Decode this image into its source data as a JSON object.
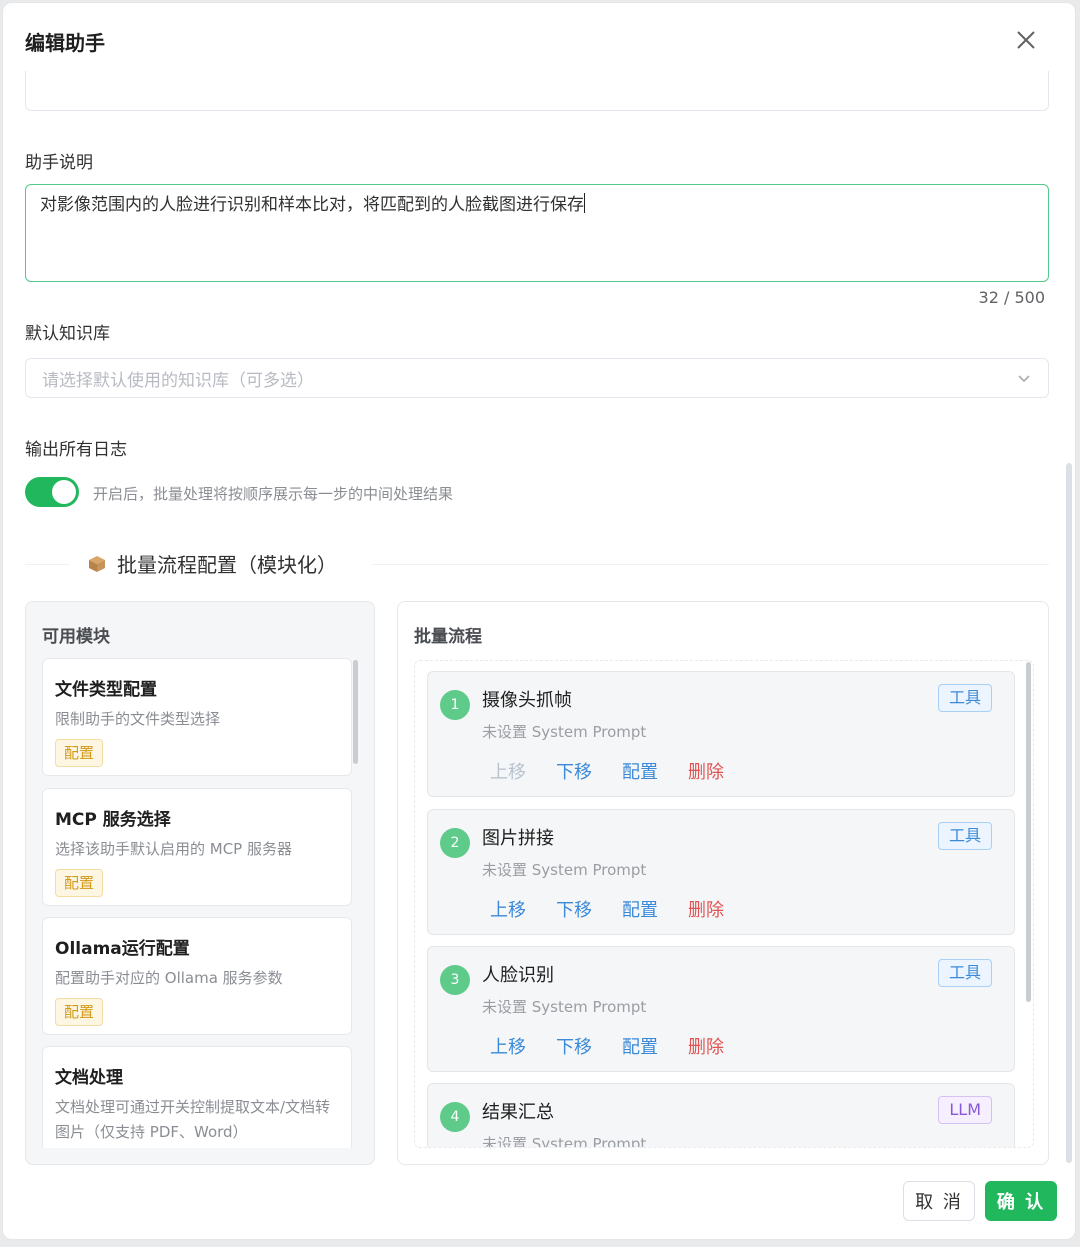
{
  "dialog": {
    "title": "编辑助手",
    "description_label": "助手说明",
    "description_value": "对影像范围内的人脸进行识别和样本比对，将匹配到的人脸截图进行保存",
    "description_counter": "32 / 500",
    "kb_label": "默认知识库",
    "kb_placeholder": "请选择默认使用的知识库（可多选）",
    "log_label": "输出所有日志",
    "log_toggle_on": true,
    "log_desc": "开启后，批量处理将按顺序展示每一步的中间处理结果",
    "section_title": "批量流程配置（模块化）",
    "cancel_label": "取 消",
    "ok_label": "确 认"
  },
  "modules": {
    "title": "可用模块",
    "items": [
      {
        "name": "文件类型配置",
        "desc": "限制助手的文件类型选择",
        "tag": "配置"
      },
      {
        "name": "MCP 服务选择",
        "desc": "选择该助手默认启用的 MCP 服务器",
        "tag": "配置"
      },
      {
        "name": "Ollama运行配置",
        "desc": "配置助手对应的 Ollama 服务参数",
        "tag": "配置"
      },
      {
        "name": "文档处理",
        "desc": "文档处理可通过开关控制提取文本/文档转图片（仅支持 PDF、Word）",
        "tag": ""
      }
    ]
  },
  "flow": {
    "title": "批量流程",
    "actions": {
      "up": "上移",
      "down": "下移",
      "config": "配置",
      "delete": "删除"
    },
    "steps": [
      {
        "num": "1",
        "name": "摄像头抓帧",
        "prompt": "未设置 System Prompt",
        "tag": "工具",
        "up_disabled": true
      },
      {
        "num": "2",
        "name": "图片拼接",
        "prompt": "未设置 System Prompt",
        "tag": "工具",
        "up_disabled": false
      },
      {
        "num": "3",
        "name": "人脸识别",
        "prompt": "未设置 System Prompt",
        "tag": "工具",
        "up_disabled": false
      },
      {
        "num": "4",
        "name": "结果汇总",
        "prompt": "未设置 System Prompt",
        "tag": "LLM",
        "up_disabled": false
      }
    ]
  },
  "colors": {
    "accent": "#21b85d",
    "link": "#3b8ad9",
    "danger": "#e05353"
  },
  "icons": {
    "close": "close-icon",
    "chevron": "chevron-down-icon",
    "section": "package-icon"
  }
}
